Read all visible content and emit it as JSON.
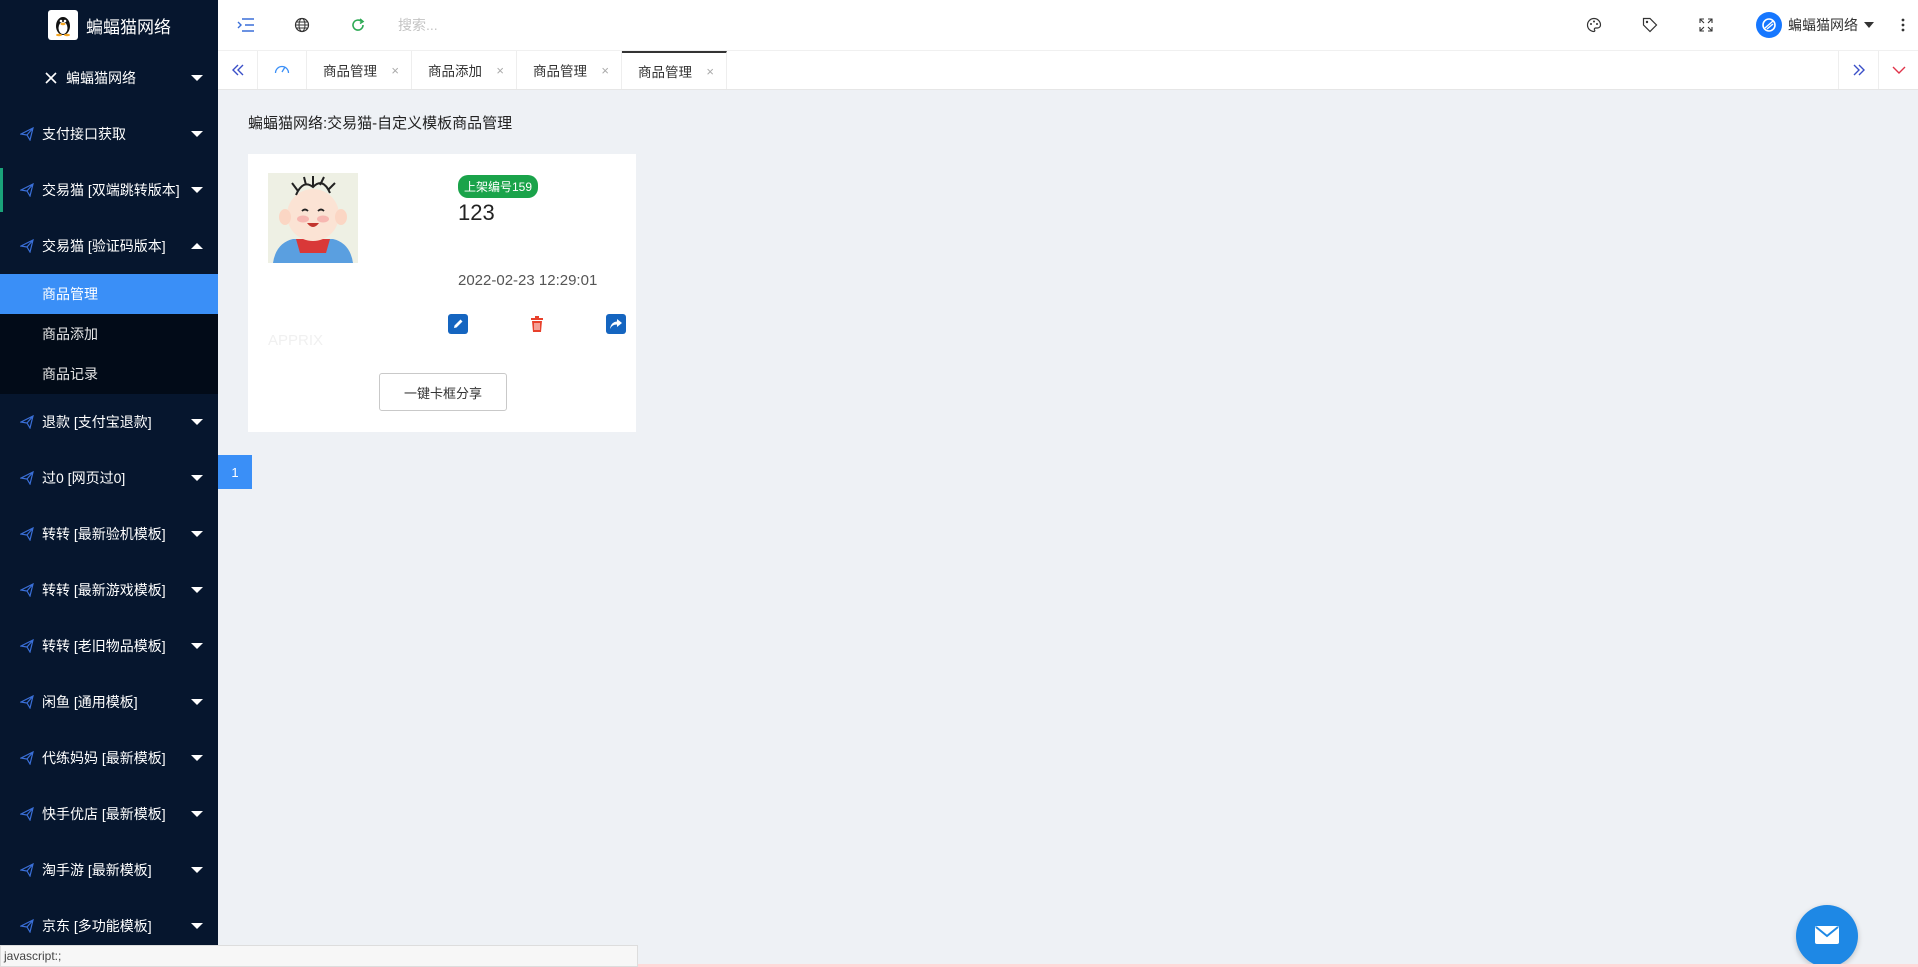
{
  "sidebar": {
    "brand": "蝙蝠猫网络",
    "top_item": "蝙蝠猫网络",
    "items_before": [
      {
        "label": "支付接口获取"
      },
      {
        "label": "交易猫 [双端跳转版本]"
      }
    ],
    "open_item": {
      "label": "交易猫 [验证码版本]"
    },
    "submenu": [
      {
        "label": "商品管理"
      },
      {
        "label": "商品添加"
      },
      {
        "label": "商品记录"
      }
    ],
    "items_after": [
      {
        "label": "退款 [支付宝退款]"
      },
      {
        "label": "过0 [网页过0]"
      },
      {
        "label": "转转 [最新验机模板]"
      },
      {
        "label": "转转 [最新游戏模板]"
      },
      {
        "label": "转转 [老旧物品模板]"
      },
      {
        "label": "闲鱼 [通用模板]"
      },
      {
        "label": "代练妈妈 [最新模板]"
      },
      {
        "label": "快手优店 [最新模板]"
      },
      {
        "label": "淘手游 [最新模板]"
      },
      {
        "label": "京东 [多功能模板]"
      }
    ]
  },
  "topbar": {
    "search_placeholder": "搜索...",
    "user_name": "蝙蝠猫网络"
  },
  "tabs": [
    {
      "label": "商品管理"
    },
    {
      "label": "商品添加"
    },
    {
      "label": "商品管理"
    },
    {
      "label": "商品管理",
      "active": true
    }
  ],
  "tab_close": "×",
  "page": {
    "title": "蝙蝠猫网络:交易猫-自定义模板商品管理",
    "product": {
      "badge": "上架编号159",
      "title": "123",
      "time": "2022-02-23 12:29:01",
      "watermark": "APPRIX"
    },
    "share_button": "一键卡框分享",
    "page_number": "1"
  },
  "status_bar": "javascript:;",
  "colors": {
    "sidebar_bg": "#06162e",
    "accent": "#3a8ff7",
    "badge_green": "#1aa34a",
    "delete_red": "#e8412c",
    "edit_blue": "#1565c0"
  }
}
